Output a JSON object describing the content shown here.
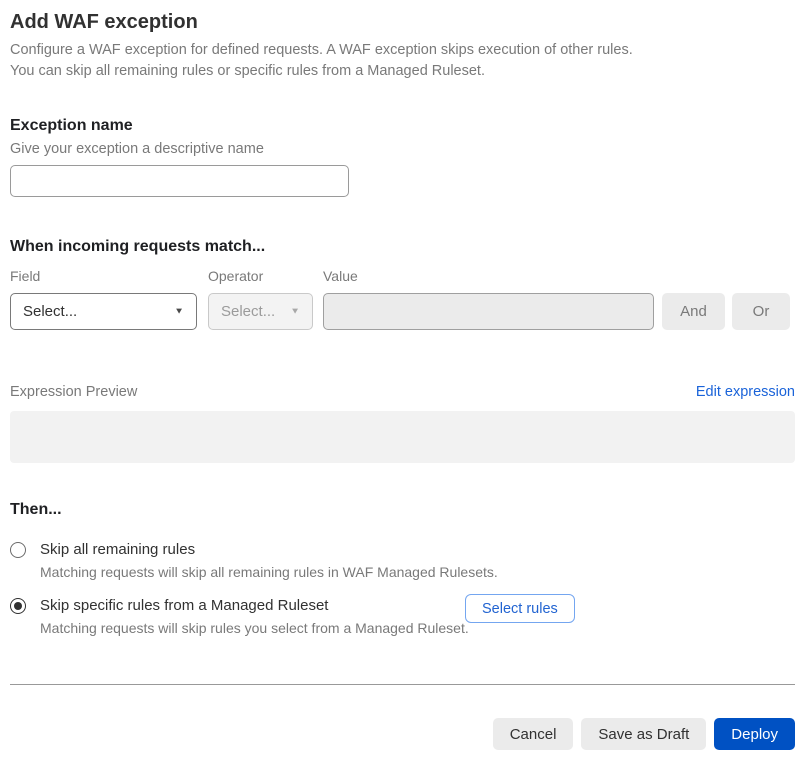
{
  "header": {
    "title": "Add WAF exception",
    "description_line1": "Configure a WAF exception for defined requests. A WAF exception skips execution of other rules.",
    "description_line2": "You can skip all remaining rules or specific rules from a Managed Ruleset."
  },
  "exception_name": {
    "heading": "Exception name",
    "helper": "Give your exception a descriptive name",
    "value": ""
  },
  "match": {
    "heading": "When incoming requests match...",
    "field_label": "Field",
    "operator_label": "Operator",
    "value_label": "Value",
    "field_selected": "Select...",
    "operator_selected": "Select...",
    "operator_disabled": true,
    "value": "",
    "value_disabled": true,
    "and_label": "And",
    "or_label": "Or"
  },
  "expression": {
    "label": "Expression Preview",
    "edit_link": "Edit expression",
    "preview_text": ""
  },
  "then": {
    "heading": "Then...",
    "options": [
      {
        "label": "Skip all remaining rules",
        "description": "Matching requests will skip all remaining rules in WAF Managed Rulesets.",
        "selected": false
      },
      {
        "label": "Skip specific rules from a Managed Ruleset",
        "description": "Matching requests will skip rules you select from a Managed Ruleset.",
        "selected": true,
        "action_label": "Select rules"
      }
    ]
  },
  "footer": {
    "cancel_label": "Cancel",
    "save_draft_label": "Save as Draft",
    "deploy_label": "Deploy"
  },
  "icons": {
    "field_dropdown": "chevron-down-icon",
    "operator_dropdown": "chevron-down-icon"
  },
  "colors": {
    "primary_blue": "#0051c3",
    "link_blue": "#1a63d9",
    "outline_blue": "#74a6f0",
    "heading_text": "#313131",
    "muted_text": "#797979",
    "button_grey": "#ebebeb",
    "preview_grey": "#f2f2f2",
    "disabled_bg": "#f3f3f3"
  }
}
